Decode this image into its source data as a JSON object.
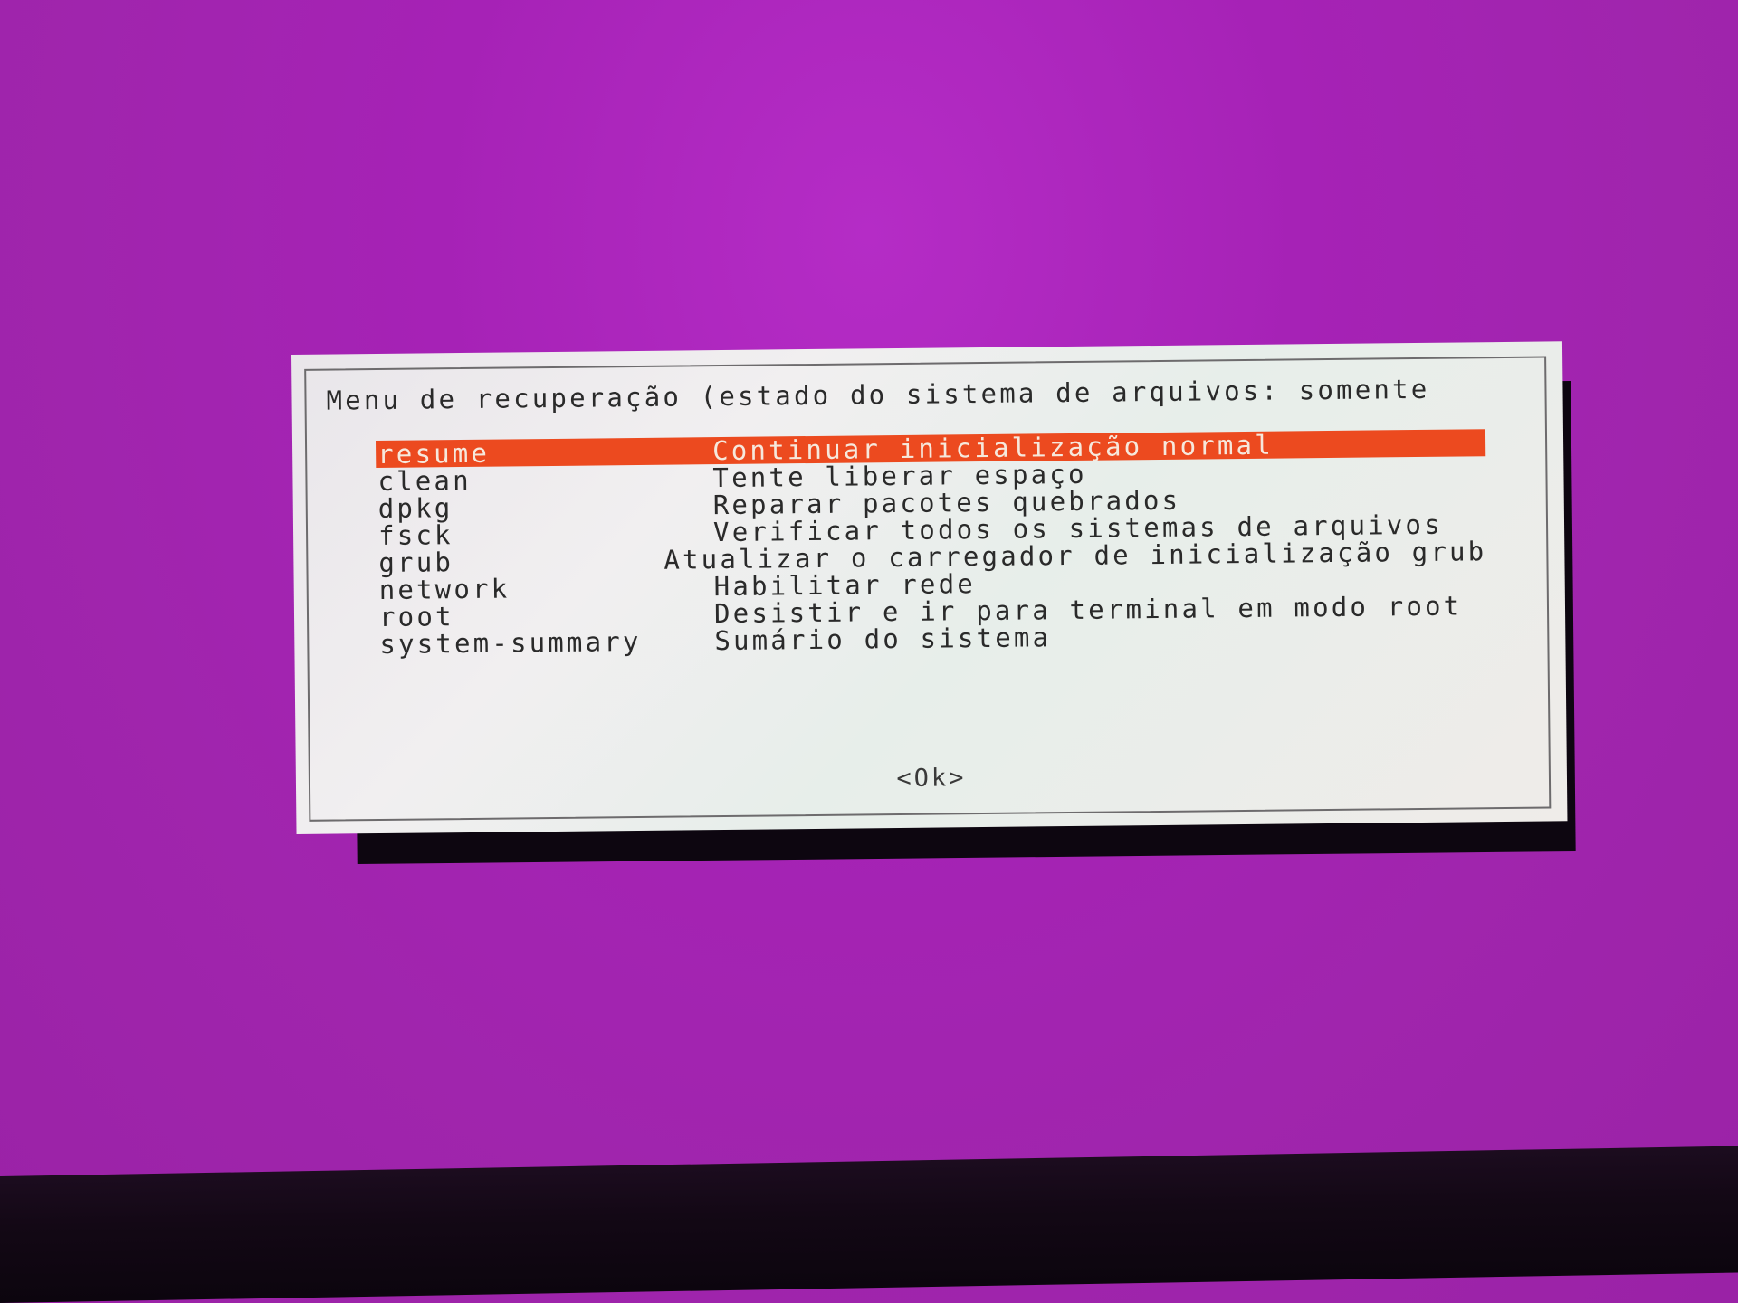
{
  "dialog": {
    "title": "Menu de recuperação (estado do sistema de arquivos: somente",
    "ok_label": "<Ok>",
    "items": [
      {
        "tag": "resume",
        "desc": "Continuar inicialização normal"
      },
      {
        "tag": "clean",
        "desc": "Tente liberar espaço"
      },
      {
        "tag": "dpkg",
        "desc": "Reparar pacotes quebrados"
      },
      {
        "tag": "fsck",
        "desc": "Verificar todos os sistemas de arquivos"
      },
      {
        "tag": "grub",
        "desc": "Atualizar o carregador de inicialização grub"
      },
      {
        "tag": "network",
        "desc": "Habilitar rede"
      },
      {
        "tag": "root",
        "desc": "Desistir e ir para terminal em modo root"
      },
      {
        "tag": "system-summary",
        "desc": "Sumário do sistema"
      }
    ],
    "selected_index": 0
  },
  "colors": {
    "background": "#a622b6",
    "dialog": "#eeecee",
    "highlight": "#ec4a1f",
    "text": "#2a2a2a"
  }
}
